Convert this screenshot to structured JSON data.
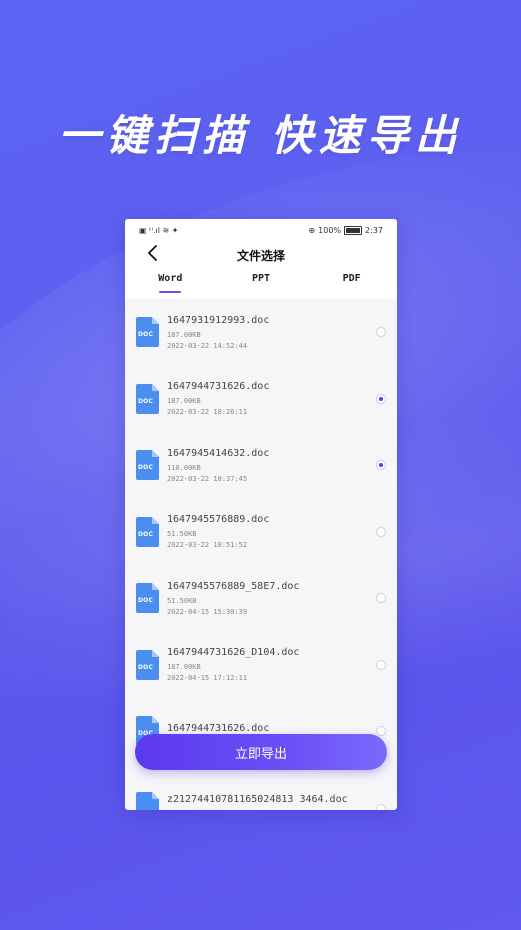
{
  "hero": {
    "title": "一键扫描 快速导出"
  },
  "status": {
    "left": "▣ ᵗᴵ.ıl ≋ ✦",
    "battery_pct": "100%",
    "time": "2:37",
    "signal": "⊕"
  },
  "nav": {
    "title": "文件选择"
  },
  "tabs": [
    {
      "label": "Word",
      "active": true
    },
    {
      "label": "PPT",
      "active": false
    },
    {
      "label": "PDF",
      "active": false
    }
  ],
  "files": [
    {
      "name": "1647931912993.doc",
      "size": "187.00KB",
      "date": "2022-03-22 14:52:44",
      "checked": false,
      "badge": "DOC"
    },
    {
      "name": "1647944731626.doc",
      "size": "187.00KB",
      "date": "2022-03-22 18:26:11",
      "checked": true,
      "badge": "DOC"
    },
    {
      "name": "1647945414632.doc",
      "size": "110.00KB",
      "date": "2022-03-22 18:37:45",
      "checked": true,
      "badge": "DOC"
    },
    {
      "name": "1647945576889.doc",
      "size": "51.50KB",
      "date": "2022-03-22 18:51:52",
      "checked": false,
      "badge": "DOC"
    },
    {
      "name": "1647945576889_58E7.doc",
      "size": "51.50KB",
      "date": "2022-04-15 15:30:39",
      "checked": false,
      "badge": "DOC"
    },
    {
      "name": "1647944731626_D104.doc",
      "size": "187.00KB",
      "date": "2022-04-15 17:12:11",
      "checked": false,
      "badge": "DOC"
    },
    {
      "name": "1647944731626.doc",
      "size": "",
      "date": "",
      "checked": false,
      "badge": "DOC"
    }
  ],
  "last_file": {
    "name": "z21274410781165024813 3464.doc",
    "badge": "DOC"
  },
  "export": {
    "label": "立即导出"
  },
  "colors": {
    "accent": "#5b57ef",
    "doc_icon": "#4a8ef0",
    "background": "#5c5ff0"
  }
}
